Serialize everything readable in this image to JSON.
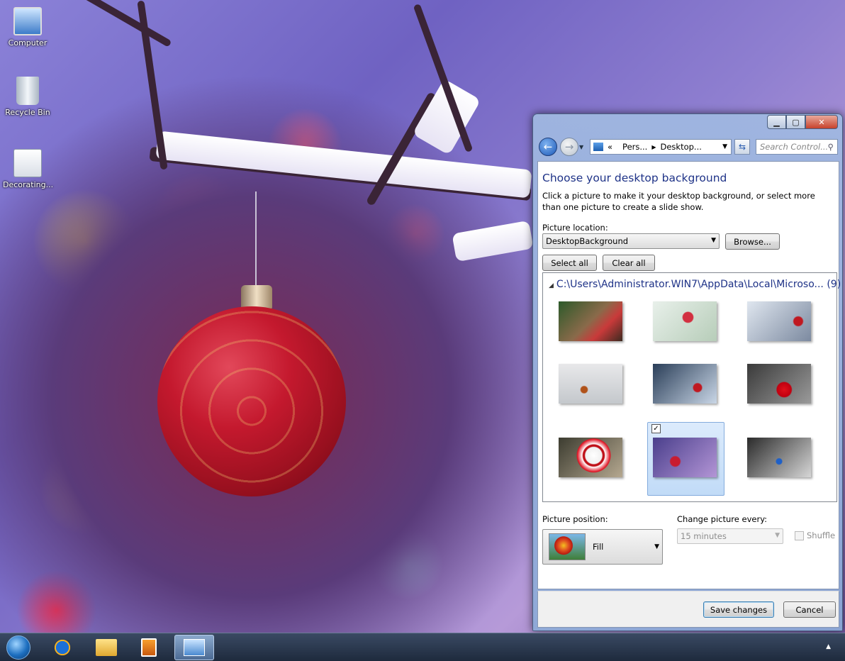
{
  "desktop": {
    "icons": [
      {
        "label": "Computer"
      },
      {
        "label": "Recycle Bin"
      },
      {
        "label": "Decorating..."
      }
    ]
  },
  "window": {
    "breadcrumb": {
      "chevrons": "«",
      "items": [
        "Pers...",
        "Desktop..."
      ]
    },
    "search_placeholder": "Search Control...",
    "heading": "Choose your desktop background",
    "description": "Click a picture to make it your desktop background, or select more than one picture to create a slide show.",
    "picture_location": {
      "label": "Picture location:",
      "value": "DesktopBackground"
    },
    "browse_label": "Browse...",
    "select_all_label": "Select all",
    "clear_all_label": "Clear all",
    "group": {
      "path": "C:\\Users\\Administrator.WIN7\\AppData\\Local\\Microso...",
      "count": "(9)"
    },
    "picture_position": {
      "label": "Picture position:",
      "value": "Fill"
    },
    "change_picture": {
      "label": "Change picture every:",
      "value": "15 minutes"
    },
    "shuffle_label": "Shuffle",
    "save_label": "Save changes",
    "cancel_label": "Cancel",
    "selected_thumb_index": 7,
    "selected_checked": true
  },
  "colors": {
    "heading": "#1e3287",
    "selection": "#c1dbf7"
  },
  "icons": [
    "back-icon",
    "forward-icon",
    "control-panel-icon",
    "refresh-icon",
    "search-icon",
    "minimize-icon",
    "maximize-icon",
    "close-icon",
    "start-orb-icon",
    "internet-explorer-icon",
    "explorer-icon",
    "media-player-icon",
    "personalization-icon"
  ]
}
